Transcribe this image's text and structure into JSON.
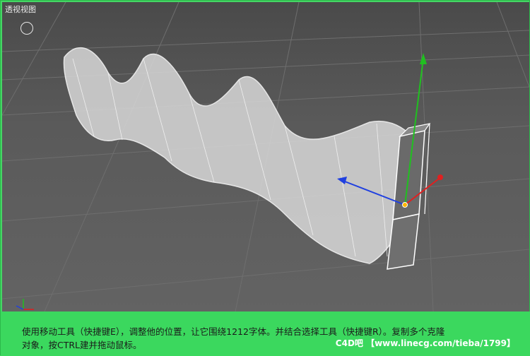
{
  "viewport": {
    "title": "透视视图"
  },
  "caption": {
    "line1": "使用移动工具（快捷键E），调整他的位置，让它围绕1212字体。并结合选择工具（快捷键R）。复制多个克隆",
    "line2": "对象，按CTRL建并拖动鼠标。",
    "watermark": "C4D吧 【www.linecg.com/tieba/1799】"
  },
  "colors": {
    "viewport_bg": "#555555",
    "caption_bg": "#3bd85e",
    "axis_x": "#e02020",
    "axis_y": "#20c020",
    "axis_z": "#2040e0"
  }
}
